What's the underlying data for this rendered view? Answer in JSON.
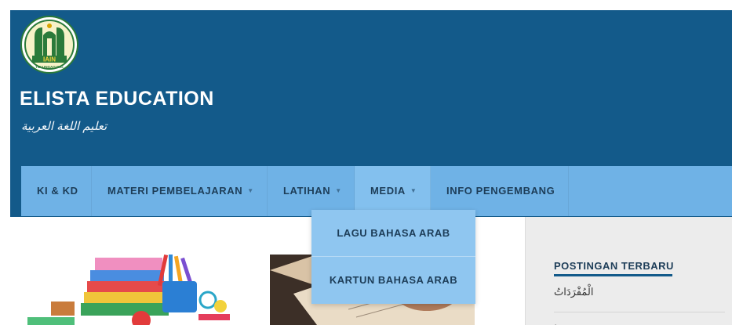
{
  "site": {
    "title": "ELISTA EDUCATION",
    "tagline": "تعليم اللغة العربية",
    "logo_text": "IAIN",
    "logo_subtext": "TULUNGAGUNG"
  },
  "nav": {
    "items": [
      {
        "label": "KI & KD",
        "has_caret": false
      },
      {
        "label": "MATERI PEMBELAJARAN",
        "has_caret": true
      },
      {
        "label": "LATIHAN",
        "has_caret": true
      },
      {
        "label": "MEDIA",
        "has_caret": true
      },
      {
        "label": "INFO PENGEMBANG",
        "has_caret": false
      }
    ],
    "caret": "▼"
  },
  "dropdown": {
    "items": [
      {
        "label": "LAGU BAHASA ARAB"
      },
      {
        "label": "KARTUN BAHASA ARAB"
      }
    ]
  },
  "sidebar": {
    "widget_title": "POSTINGAN TERBARU",
    "posts": [
      {
        "title": "الْمُفْرَدَاتُ"
      },
      {
        "title": "·"
      }
    ]
  },
  "colors": {
    "header": "#135a8a",
    "navbar": "#6fb2e6",
    "dropdown": "#8fc6f0",
    "sidebar": "#ececec"
  }
}
